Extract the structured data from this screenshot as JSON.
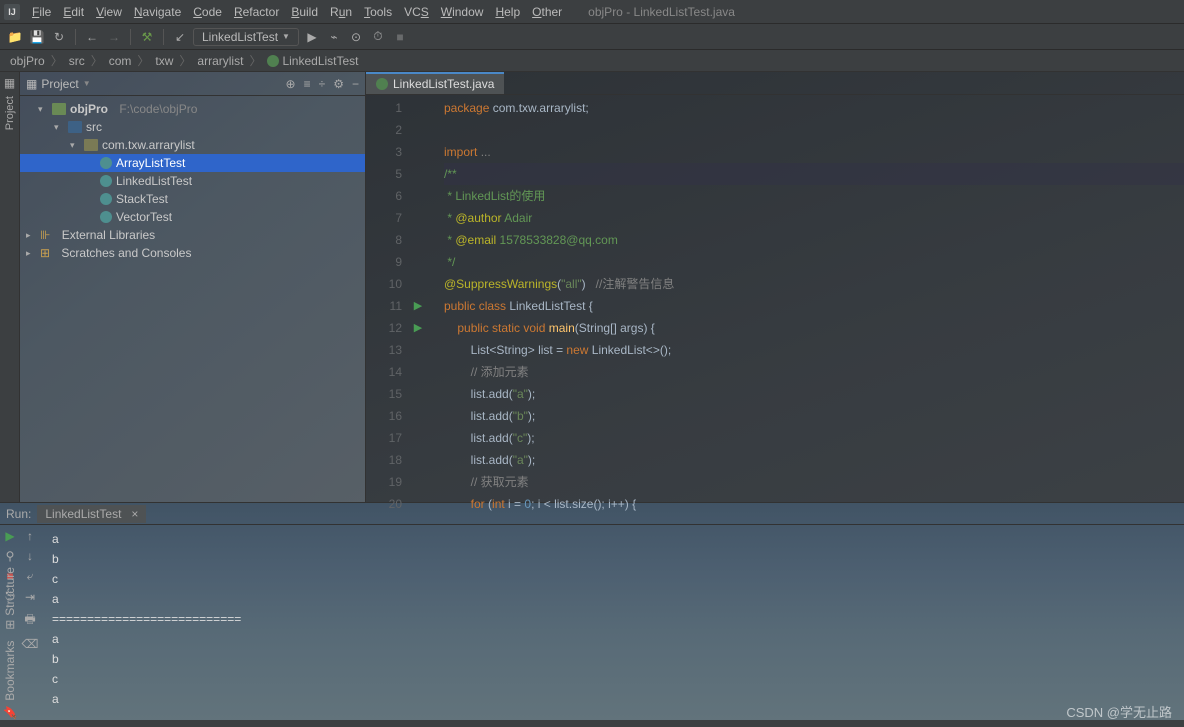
{
  "menu": {
    "items": [
      "File",
      "Edit",
      "View",
      "Navigate",
      "Code",
      "Refactor",
      "Build",
      "Run",
      "Tools",
      "VCS",
      "Window",
      "Help",
      "Other"
    ],
    "title": "objPro - LinkedListTest.java"
  },
  "toolbar": {
    "runconf": "LinkedListTest"
  },
  "breadcrumbs": [
    "objPro",
    "src",
    "com",
    "txw",
    "arrarylist",
    "LinkedListTest"
  ],
  "project": {
    "label": "Project",
    "root": {
      "name": "objPro",
      "path": "F:\\code\\objPro"
    },
    "src": "src",
    "pkg": "com.txw.arrarylist",
    "classes": [
      "ArrayListTest",
      "LinkedListTest",
      "StackTest",
      "VectorTest"
    ],
    "ext": "External Libraries",
    "scratch": "Scratches and Consoles"
  },
  "tab": {
    "name": "LinkedListTest.java"
  },
  "code": {
    "lines": [
      {
        "n": 1,
        "html": "<span class='kw'>package</span> <span class='pkg'>com.txw.arrarylist</span>;"
      },
      {
        "n": 2,
        "html": ""
      },
      {
        "n": 3,
        "html": "<span class='kw'>import</span> <span class='comm'>...</span>"
      },
      {
        "n": 5,
        "html": "<span class='doc'>/**</span>",
        "hl": true
      },
      {
        "n": 6,
        "html": "<span class='doc'> * LinkedList的使用</span>"
      },
      {
        "n": 7,
        "html": "<span class='doc'> * <span class='ann'>@author</span> Adair</span>"
      },
      {
        "n": 8,
        "html": "<span class='doc'> * <span class='ann'>@email</span> 1578533828@qq.com</span>"
      },
      {
        "n": 9,
        "html": "<span class='doc'> */</span>"
      },
      {
        "n": 10,
        "html": "<span class='ann'>@SuppressWarnings</span>(<span class='str'>\"all\"</span>)   <span class='comm'>//注解警告信息</span>"
      },
      {
        "n": 11,
        "html": "<span class='kw'>public class</span> <span class='cls'>LinkedListTest</span> {",
        "run": true
      },
      {
        "n": 12,
        "html": "    <span class='kw'>public static void</span> <span class='id'>main</span>(<span class='cls'>String</span>[] args) {",
        "run": true
      },
      {
        "n": 13,
        "html": "        <span class='cls'>List</span>&lt;<span class='cls'>String</span>&gt; list = <span class='kw'>new</span> LinkedList&lt;&gt;();"
      },
      {
        "n": 14,
        "html": "        <span class='comm'>// 添加元素</span>"
      },
      {
        "n": 15,
        "html": "        list.add(<span class='str'>\"a\"</span>);"
      },
      {
        "n": 16,
        "html": "        list.add(<span class='str'>\"b\"</span>);"
      },
      {
        "n": 17,
        "html": "        list.add(<span class='str'>\"c\"</span>);"
      },
      {
        "n": 18,
        "html": "        list.add(<span class='str'>\"a\"</span>);"
      },
      {
        "n": 19,
        "html": "        <span class='comm'>// 获取元素</span>"
      },
      {
        "n": 20,
        "html": "        <span class='kw'>for</span> (<span class='kw'>int</span> i = <span class='num'>0</span>; i &lt; list.size(); i++) {"
      }
    ]
  },
  "run": {
    "label": "Run:",
    "tab": "LinkedListTest",
    "output": [
      "a",
      "b",
      "c",
      "a",
      "===========================",
      "a",
      "b",
      "c",
      "a"
    ]
  },
  "sidetools": {
    "project": "Project",
    "structure": "Structure",
    "bookmarks": "Bookmarks"
  },
  "watermark": "CSDN @学无止路"
}
